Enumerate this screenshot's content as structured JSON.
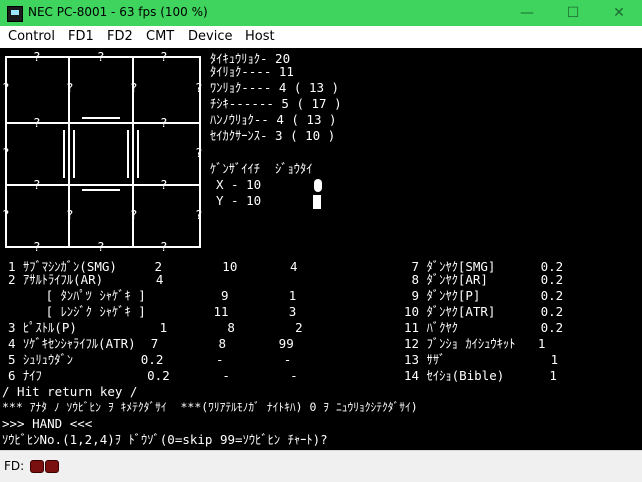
{
  "window": {
    "title": "NEC PC-8001 - 63 fps (100 %)"
  },
  "controls": {
    "minimize": "—",
    "maximize": "☐",
    "close": "✕"
  },
  "menu": [
    "Control",
    "FD1",
    "FD2",
    "CMT",
    "Device",
    "Host"
  ],
  "map": {
    "marker": "?"
  },
  "stats": [
    "ﾀｲｷｭｳﾘｮｸ- 20",
    "ﾀｲﾘｮｸ---- 11",
    "ﾜﾝﾘｮｸ---- 4 ( 13 )",
    "ﾁｼｷ------ 5 ( 17 )",
    "ﾊﾝﾉｳﾘｮｸ-- 4 ( 13 )",
    "ｾｲｶｸｻｰﾝｽ- 3 ( 10 )"
  ],
  "position": {
    "header": "ｹﾞﾝｻﾞｲｲﾁ  ｼﾞｮｳﾀｲ",
    "x": "X - 10",
    "y": "Y - 10"
  },
  "weapons": [
    "1 ｻﾌﾞﾏｼﾝｶﾞﾝ(SMG)     2        10       4",
    "2 ｱｻﾙﾄﾗｲﾌﾙ(AR)       4",
    "     [ ﾀﾝﾊﾟﾂ ｼｬｹﾞｷ ]          9        1",
    "     [ ﾚﾝｼﾞｸ ｼｬｹﾞｷ ]         11        3",
    "3 ﾋﾟｽﾄﾙ(P)           1        8        2",
    "4 ｿｹﾞｷｾﾝｼｬﾗｲﾌﾙ(ATR)  7        8       99",
    "5 ｼｭﾘｭｳﾀﾞﾝ         0.2       -        -",
    "6 ﾅｲﾌ              0.2       -        -"
  ],
  "items": [
    " 7 ﾀﾞﾝﾔｸ[SMG]      0.2",
    " 8 ﾀﾞﾝﾔｸ[AR]       0.2",
    " 9 ﾀﾞﾝﾔｸ[P]        0.2",
    "10 ﾀﾞﾝﾔｸ[ATR]      0.2",
    "11 ﾊﾞｸﾔｸ           0.2",
    "12 ﾌﾞﾝｼｮ ｶｲｼｭｳｷｯﾄ   1",
    "13 ｻｻﾞ              1",
    "14 ｾｲｼｮ(Bible)      1"
  ],
  "messages": {
    "hit": "/ Hit return key /",
    "note": "*** ｱﾅﾀ ﾉ ｿｳﾋﾞﾋﾝ ｦ ｷﾒﾃｸﾀﾞｻｲ  ***(ﾜﾘｱﾃﾙﾓﾉｶﾞ ﾅｲﾄｷﾊ) 0 ｦ ﾆｭｳﾘｮｸｼﾃｸﾀﾞｻｲ)",
    "hand": ">>> HAND <<<",
    "prompt": "ｿｳﾋﾞﾋﾝNo.(1,2,4)ｦ ﾄﾞｳｿﾞ(0=skip 99=ｿｳﾋﾞﾋﾝ ﾁｬｰﾄ)?"
  },
  "status": {
    "label": "FD:"
  }
}
